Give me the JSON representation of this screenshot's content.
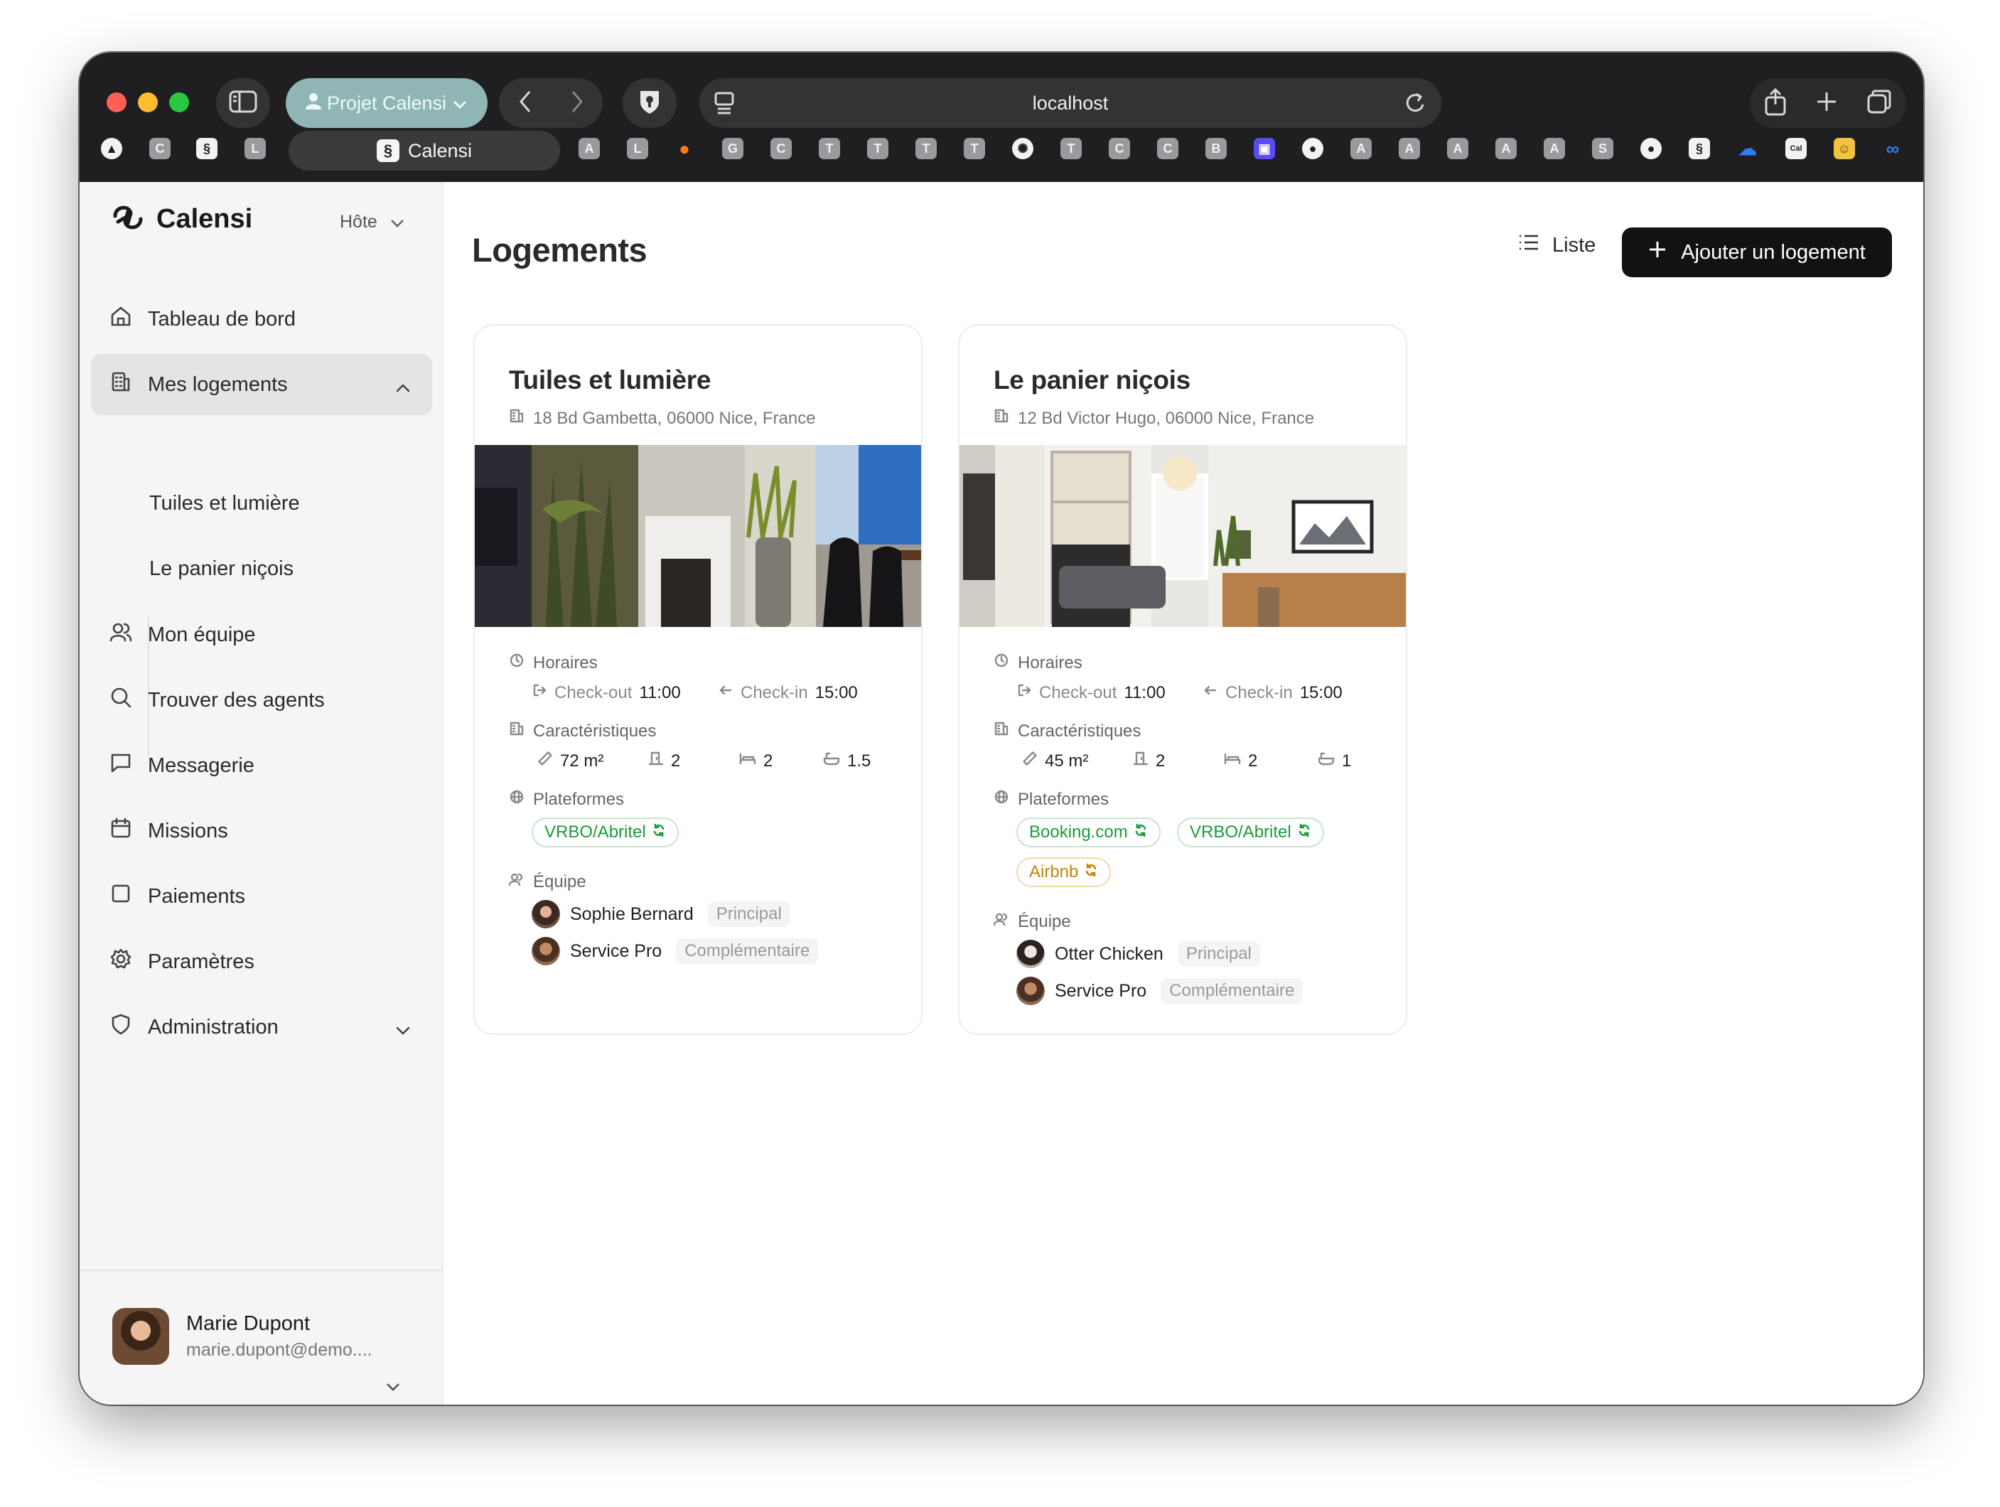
{
  "browser": {
    "profile_label": "Projet Calensi",
    "url": "localhost",
    "active_tab_label": "Calensi",
    "tab_letters": [
      "C",
      "L",
      "A",
      "L",
      "G",
      "C",
      "T",
      "T",
      "T",
      "T",
      "T",
      "C",
      "C",
      "B",
      "A",
      "A",
      "A",
      "A",
      "A",
      "S"
    ],
    "icons": [
      "sidebar-icon",
      "person-icon",
      "chevron-left-icon",
      "chevron-right-icon",
      "shield-icon",
      "reader-icon",
      "reload-icon",
      "share-icon",
      "plus-icon",
      "tabs-icon"
    ]
  },
  "sidebar": {
    "brand": "Calensi",
    "role": "Hôte",
    "items": [
      {
        "label": "Tableau de bord",
        "icon": "home-icon"
      },
      {
        "label": "Mes logements",
        "icon": "building-icon"
      },
      {
        "label": "Mon équipe",
        "icon": "users-icon"
      },
      {
        "label": "Trouver des agents",
        "icon": "search-icon"
      },
      {
        "label": "Messagerie",
        "icon": "message-icon"
      },
      {
        "label": "Missions",
        "icon": "calendar-icon"
      },
      {
        "label": "Paiements",
        "icon": "square-icon"
      },
      {
        "label": "Paramètres",
        "icon": "gear-icon"
      },
      {
        "label": "Administration",
        "icon": "shield-icon"
      }
    ],
    "subitems": [
      "Tuiles et lumière",
      "Le panier niçois"
    ],
    "user": {
      "name": "Marie Dupont",
      "email": "marie.dupont@demo...."
    }
  },
  "main": {
    "title": "Logements",
    "view_label": "Liste",
    "add_label": "Ajouter un logement",
    "labels": {
      "hours": "Horaires",
      "checkout": "Check-out",
      "checkin": "Check-in",
      "features": "Caractéristiques",
      "platforms": "Plateformes",
      "team": "Équipe"
    },
    "properties": [
      {
        "title": "Tuiles et lumière",
        "address": "18 Bd Gambetta, 06000 Nice, France",
        "checkout_time": "11:00",
        "checkin_time": "15:00",
        "area": "72 m²",
        "rooms": "2",
        "beds": "2",
        "baths": "1.5",
        "platforms": [
          "VRBO/Abritel"
        ],
        "team": [
          {
            "name": "Sophie Bernard",
            "role": "Principal"
          },
          {
            "name": "Service Pro",
            "role": "Complémentaire"
          }
        ]
      },
      {
        "title": "Le panier niçois",
        "address": "12 Bd Victor Hugo, 06000 Nice, France",
        "checkout_time": "11:00",
        "checkin_time": "15:00",
        "area": "45 m²",
        "rooms": "2",
        "beds": "2",
        "baths": "1",
        "platforms": [
          "Booking.com",
          "VRBO/Abritel",
          "Airbnb"
        ],
        "team": [
          {
            "name": "Otter Chicken",
            "role": "Principal"
          },
          {
            "name": "Service Pro",
            "role": "Complémentaire"
          }
        ]
      }
    ]
  },
  "colors": {
    "accent_dark": "#121212",
    "profile_pill": "#8fb6b4",
    "platform_green": "#1b9b3c",
    "platform_amber": "#c4830b",
    "sidebar_bg": "#f5f5f5"
  }
}
